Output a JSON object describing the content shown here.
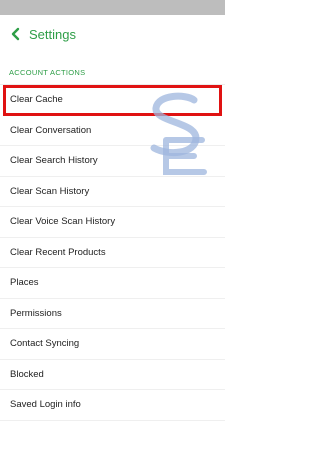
{
  "header": {
    "title": "Settings"
  },
  "section": {
    "label": "ACCOUNT ACTIONS"
  },
  "items": [
    {
      "label": "Clear Cache"
    },
    {
      "label": "Clear Conversation"
    },
    {
      "label": "Clear Search History"
    },
    {
      "label": "Clear Scan History"
    },
    {
      "label": "Clear Voice Scan History"
    },
    {
      "label": "Clear Recent Products"
    },
    {
      "label": "Places"
    },
    {
      "label": "Permissions"
    },
    {
      "label": "Contact Syncing"
    },
    {
      "label": "Blocked"
    },
    {
      "label": "Saved Login info"
    }
  ],
  "colors": {
    "accent": "#2e9e47",
    "highlight": "#e01212",
    "watermark": "#9db5dd"
  }
}
